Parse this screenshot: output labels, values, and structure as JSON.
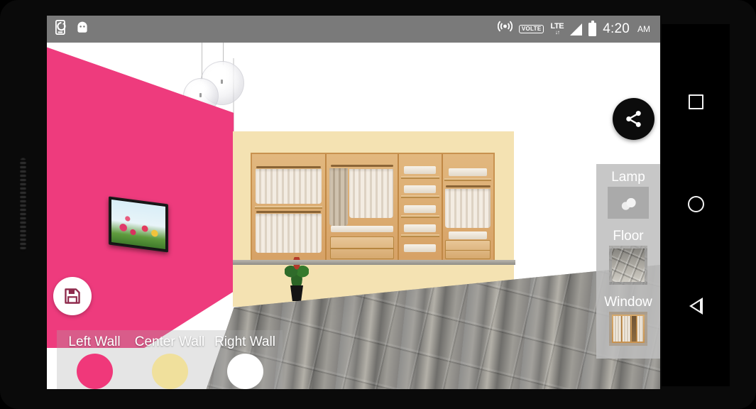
{
  "device": {
    "nav": {
      "recents_label": "Recents",
      "home_label": "Home",
      "back_label": "Back"
    }
  },
  "status_bar": {
    "left_icons": [
      {
        "name": "phone-sync-icon",
        "label": "Phone sync"
      },
      {
        "name": "android-head-icon",
        "label": "Android"
      }
    ],
    "right_icons": [
      {
        "name": "hotspot-icon",
        "label": "Hotspot"
      },
      {
        "name": "volte-icon",
        "label": "VOLTE"
      },
      {
        "name": "lte-icon",
        "label": "LTE"
      },
      {
        "name": "signal-icon",
        "label": "Signal"
      },
      {
        "name": "battery-icon",
        "label": "Battery"
      }
    ],
    "volte_text": "VOLTE",
    "lte_text": "LTE",
    "lte_arrows": "↓↑",
    "time": "4:20",
    "ampm": "AM"
  },
  "scene": {
    "left_wall_color": "#ee3b7d",
    "center_wall_color": "#f4e2b2",
    "right_wall_color": "#ffffff",
    "floor_label": "floor-plane",
    "objects": [
      {
        "name": "tv-on-wall",
        "label": "TV with tulip wallpaper"
      },
      {
        "name": "wardrobe-image",
        "label": "Wardrobe"
      },
      {
        "name": "potted-plant",
        "label": "Potted plant"
      },
      {
        "name": "pendant-lamp-large",
        "label": "Pendant lamp"
      },
      {
        "name": "pendant-lamp-small",
        "label": "Pendant lamp"
      }
    ]
  },
  "share_button": {
    "icon": "share-icon",
    "label": "Share"
  },
  "save_button": {
    "icon": "save-icon",
    "label": "Save"
  },
  "object_panel": {
    "items": [
      {
        "label": "Lamp",
        "thumb": "lamp-thumbnail"
      },
      {
        "label": "Floor",
        "thumb": "floor-thumbnail"
      },
      {
        "label": "Window",
        "thumb": "window-thumbnail"
      }
    ]
  },
  "wall_selector": {
    "items": [
      {
        "label": "Left Wall",
        "color": "#f0387a"
      },
      {
        "label": "Center Wall",
        "color": "#f0e09c"
      },
      {
        "label": "Right Wall",
        "color": "#ffffff"
      }
    ]
  }
}
